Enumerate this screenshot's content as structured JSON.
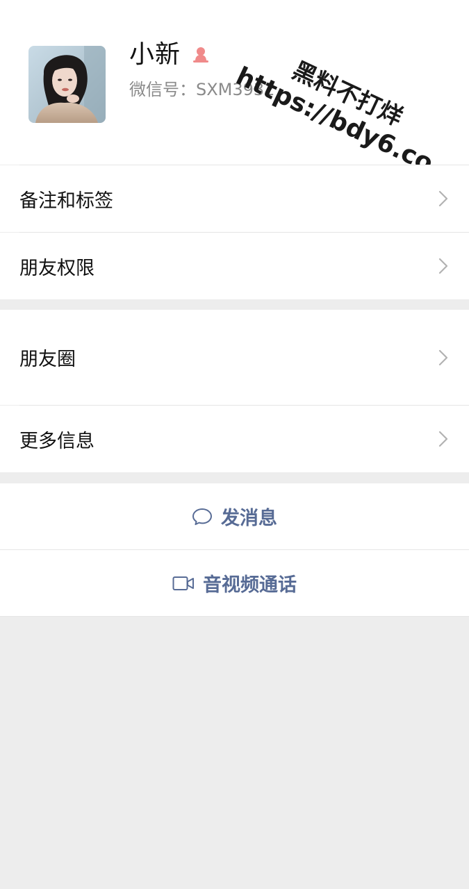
{
  "profile": {
    "name": "小新",
    "gender_icon": "female-icon",
    "wechat_id_label": "微信号：",
    "wechat_id": "SXM3932"
  },
  "watermark": {
    "line1": "黑料不打烊",
    "line2": "https://bdy6.co"
  },
  "menu": {
    "remarks_tags": "备注和标签",
    "friend_permissions": "朋友权限",
    "moments": "朋友圈",
    "more_info": "更多信息"
  },
  "actions": {
    "send_message": "发消息",
    "video_call": "音视频通话"
  },
  "colors": {
    "link_blue": "#576b95",
    "female_pink": "#f08a8a",
    "page_gray": "#ededed"
  }
}
